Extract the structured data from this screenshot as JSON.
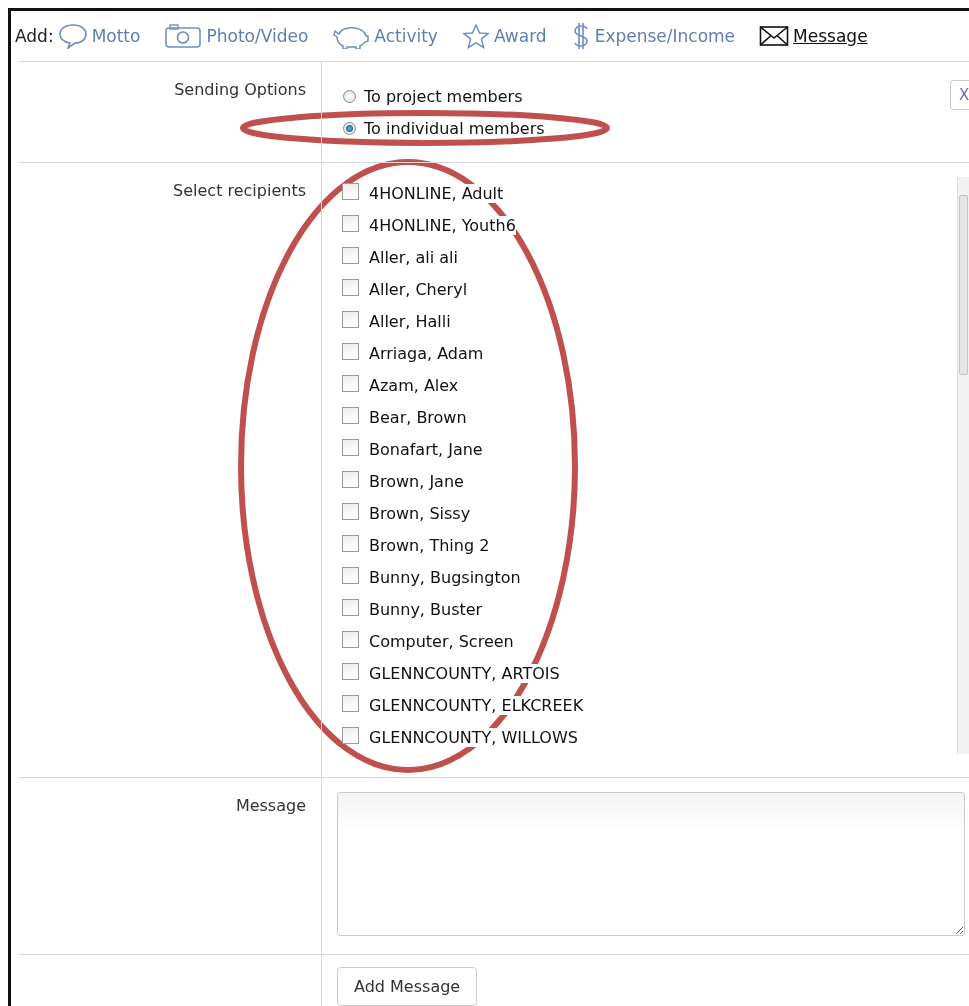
{
  "toolbar": {
    "label": "Add:",
    "items": [
      {
        "kind": "bubble",
        "label": "Motto",
        "selected": false
      },
      {
        "kind": "camera",
        "label": "Photo/Video",
        "selected": false
      },
      {
        "kind": "pig",
        "label": "Activity",
        "selected": false
      },
      {
        "kind": "star",
        "label": "Award",
        "selected": false
      },
      {
        "kind": "dollar",
        "label": "Expense/Income",
        "selected": false
      },
      {
        "kind": "envelope",
        "label": "Message",
        "selected": true
      }
    ]
  },
  "sending_options": {
    "label": "Sending Options",
    "close": "X",
    "options": [
      {
        "label": "To project members",
        "selected": false
      },
      {
        "label": "To individual members",
        "selected": true
      }
    ]
  },
  "recipients": {
    "label": "Select recipients",
    "items": [
      {
        "name": "4HONLINE, Adult",
        "checked": false
      },
      {
        "name": "4HONLINE, Youth6",
        "checked": false
      },
      {
        "name": "Aller, ali ali",
        "checked": false
      },
      {
        "name": "Aller, Cheryl",
        "checked": false
      },
      {
        "name": "Aller, Halli",
        "checked": false
      },
      {
        "name": "Arriaga, Adam",
        "checked": false
      },
      {
        "name": "Azam, Alex",
        "checked": false
      },
      {
        "name": "Bear, Brown",
        "checked": false
      },
      {
        "name": "Bonafart, Jane",
        "checked": false
      },
      {
        "name": "Brown, Jane",
        "checked": false
      },
      {
        "name": "Brown, Sissy",
        "checked": false
      },
      {
        "name": "Brown, Thing 2",
        "checked": false
      },
      {
        "name": "Bunny, Bugsington",
        "checked": false
      },
      {
        "name": "Bunny, Buster",
        "checked": false
      },
      {
        "name": "Computer, Screen",
        "checked": false
      },
      {
        "name": "GLENNCOUNTY, ARTOIS",
        "checked": false
      },
      {
        "name": "GLENNCOUNTY, ELKCREEK",
        "checked": false
      },
      {
        "name": "GLENNCOUNTY, WILLOWS",
        "checked": false
      }
    ]
  },
  "message": {
    "label": "Message"
  },
  "submit": {
    "label": "Add Message"
  },
  "annotations": [
    {
      "kind": "ellipse"
    },
    {
      "kind": "ellipse"
    }
  ]
}
